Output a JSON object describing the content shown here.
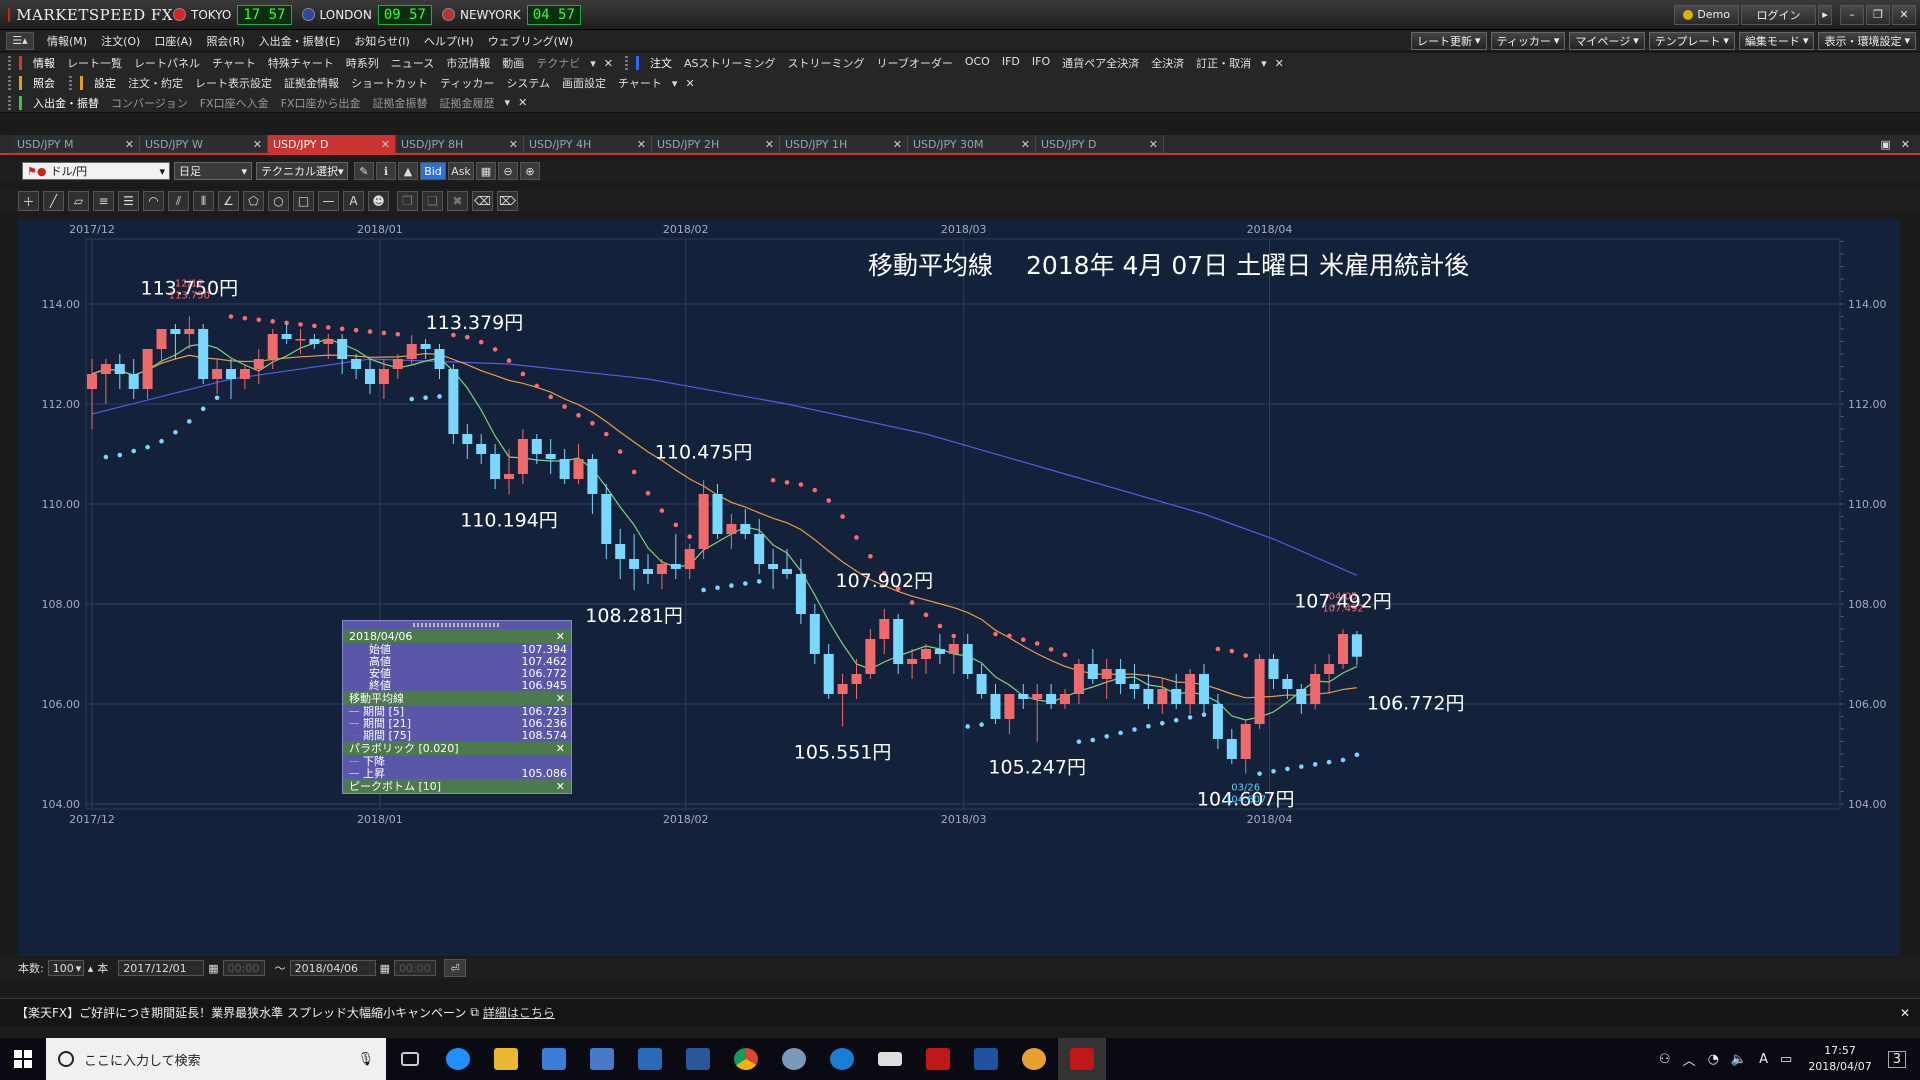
{
  "app": {
    "title": "MARKETSPEED FX",
    "clocks": [
      {
        "city": "TOKYO",
        "time": "17 57",
        "flag": "#dd2222"
      },
      {
        "city": "LONDON",
        "time": "09 57",
        "flag": "#2a4aa0"
      },
      {
        "city": "NEWYORK",
        "time": "04 57",
        "flag": "#c03030"
      }
    ],
    "demo_label": "Demo",
    "login_label": "ログイン"
  },
  "menu": {
    "items": [
      "情報(M)",
      "注文(O)",
      "口座(A)",
      "照会(R)",
      "入出金・振替(E)",
      "お知らせ(I)",
      "ヘルプ(H)",
      "ウェブリング(W)"
    ],
    "right_buttons": [
      "レート更新",
      "ティッカー",
      "マイページ",
      "テンプレート",
      "編集モード",
      "表示・環境設定"
    ]
  },
  "toolbar1": {
    "info_head": "情報",
    "info_items": [
      "レート一覧",
      "レートパネル",
      "チャート",
      "特殊チャート",
      "時系列",
      "ニュース",
      "市況情報",
      "動画"
    ],
    "info_dim": "テクナビ",
    "order_head": "注文",
    "order_items": [
      "ASストリーミング",
      "ストリーミング",
      "リーブオーダー",
      "OCO",
      "IFD",
      "IFO",
      "通貨ペア全決済",
      "全決済",
      "訂正・取消"
    ]
  },
  "toolbar2": {
    "query_head": "照会",
    "settings_head": "設定",
    "settings_items": [
      "注文・約定",
      "レート表示設定",
      "証拠金情報",
      "ショートカット",
      "ティッカー",
      "システム",
      "画面設定",
      "チャート"
    ]
  },
  "toolbar3": {
    "funds_head": "入出金・振替",
    "funds_items": [
      "コンバージョン",
      "FX口座へ入金",
      "FX口座から出金",
      "証拠金振替",
      "証拠金履歴"
    ]
  },
  "tabs": [
    "USD/JPY M",
    "USD/JPY W",
    "USD/JPY D",
    "USD/JPY 8H",
    "USD/JPY 4H",
    "USD/JPY 2H",
    "USD/JPY 1H",
    "USD/JPY 30M",
    "USD/JPY D"
  ],
  "active_tab_index": 2,
  "controls": {
    "pair": "ドル/円",
    "period": "日足",
    "technical": "テクニカル選択",
    "bid": "Bid",
    "ask": "Ask"
  },
  "chart_data": {
    "type": "candlestick",
    "title": "移動平均線　 2018年 4月 07日 土曜日 米雇用統計後",
    "ylim": [
      103.9,
      115.3
    ],
    "yticks": [
      "114.00",
      "112.00",
      "110.00",
      "108.00",
      "106.00",
      "104.00"
    ],
    "ytick_values": [
      114,
      112,
      110,
      108,
      106,
      104
    ],
    "xticks": [
      {
        "label": "2017/12",
        "index": 0
      },
      {
        "label": "2018/01",
        "index": 21
      },
      {
        "label": "2018/02",
        "index": 43
      },
      {
        "label": "2018/03",
        "index": 63
      },
      {
        "label": "2018/04",
        "index": 85
      }
    ],
    "ohlc": [
      [
        112.3,
        112.9,
        111.5,
        112.6
      ],
      [
        112.6,
        112.9,
        112.0,
        112.8
      ],
      [
        112.8,
        113.0,
        112.3,
        112.6
      ],
      [
        112.6,
        112.9,
        112.1,
        112.3
      ],
      [
        112.3,
        113.1,
        112.1,
        113.1
      ],
      [
        113.1,
        113.5,
        112.8,
        113.5
      ],
      [
        113.5,
        113.6,
        112.9,
        113.4
      ],
      [
        113.4,
        113.75,
        113.1,
        113.5
      ],
      [
        113.5,
        113.6,
        112.4,
        112.5
      ],
      [
        112.5,
        112.9,
        112.2,
        112.7
      ],
      [
        112.7,
        112.9,
        112.1,
        112.5
      ],
      [
        112.5,
        112.8,
        112.3,
        112.7
      ],
      [
        112.7,
        113.1,
        112.4,
        112.9
      ],
      [
        112.9,
        113.5,
        112.7,
        113.4
      ],
      [
        113.4,
        113.6,
        113.2,
        113.3
      ],
      [
        113.3,
        113.5,
        113.0,
        113.3
      ],
      [
        113.3,
        113.4,
        113.1,
        113.2
      ],
      [
        113.2,
        113.4,
        112.9,
        113.3
      ],
      [
        113.3,
        113.4,
        112.6,
        112.9
      ],
      [
        112.9,
        113.0,
        112.5,
        112.7
      ],
      [
        112.7,
        112.9,
        112.2,
        112.4
      ],
      [
        112.4,
        112.9,
        112.1,
        112.7
      ],
      [
        112.7,
        113.0,
        112.5,
        112.9
      ],
      [
        112.9,
        113.379,
        112.8,
        113.2
      ],
      [
        113.2,
        113.3,
        112.9,
        113.1
      ],
      [
        113.1,
        113.2,
        112.5,
        112.7
      ],
      [
        112.7,
        112.8,
        111.2,
        111.4
      ],
      [
        111.4,
        111.6,
        110.9,
        111.2
      ],
      [
        111.2,
        111.4,
        110.8,
        111.0
      ],
      [
        111.0,
        111.2,
        110.3,
        110.5
      ],
      [
        110.5,
        111.1,
        110.194,
        110.6
      ],
      [
        110.6,
        111.5,
        110.4,
        111.3
      ],
      [
        111.3,
        111.4,
        110.8,
        111.0
      ],
      [
        111.0,
        111.3,
        110.6,
        110.9
      ],
      [
        110.9,
        111.1,
        110.4,
        110.5
      ],
      [
        110.5,
        111.2,
        110.4,
        110.9
      ],
      [
        110.9,
        111.0,
        109.8,
        110.2
      ],
      [
        110.2,
        110.4,
        108.9,
        109.2
      ],
      [
        109.2,
        109.5,
        108.5,
        108.9
      ],
      [
        108.9,
        109.4,
        108.281,
        108.7
      ],
      [
        108.7,
        109.0,
        108.4,
        108.6
      ],
      [
        108.6,
        108.9,
        108.3,
        108.8
      ],
      [
        108.8,
        109.4,
        108.5,
        108.7
      ],
      [
        108.7,
        109.2,
        108.5,
        109.1
      ],
      [
        109.1,
        110.475,
        108.9,
        110.2
      ],
      [
        110.2,
        110.4,
        109.3,
        109.4
      ],
      [
        109.4,
        109.8,
        109.1,
        109.6
      ],
      [
        109.6,
        109.9,
        109.3,
        109.4
      ],
      [
        109.4,
        109.7,
        108.6,
        108.8
      ],
      [
        108.8,
        109.1,
        108.3,
        108.7
      ],
      [
        108.7,
        109.1,
        108.5,
        108.6
      ],
      [
        108.6,
        108.9,
        107.6,
        107.8
      ],
      [
        107.8,
        108.0,
        106.8,
        107.0
      ],
      [
        107.0,
        107.2,
        106.1,
        106.2
      ],
      [
        106.2,
        106.6,
        105.551,
        106.4
      ],
      [
        106.4,
        106.9,
        106.1,
        106.6
      ],
      [
        106.6,
        107.5,
        106.5,
        107.3
      ],
      [
        107.3,
        107.902,
        107.0,
        107.7
      ],
      [
        107.7,
        107.8,
        106.6,
        106.8
      ],
      [
        106.8,
        107.1,
        106.5,
        106.9
      ],
      [
        106.9,
        107.2,
        106.6,
        107.1
      ],
      [
        107.1,
        107.4,
        106.8,
        107.0
      ],
      [
        107.0,
        107.3,
        106.6,
        107.2
      ],
      [
        107.2,
        107.4,
        106.5,
        106.6
      ],
      [
        106.6,
        106.8,
        106.1,
        106.2
      ],
      [
        106.2,
        106.4,
        105.6,
        105.7
      ],
      [
        105.7,
        106.2,
        105.4,
        106.2
      ],
      [
        106.2,
        106.4,
        105.9,
        106.1
      ],
      [
        106.1,
        106.4,
        105.247,
        106.2
      ],
      [
        106.2,
        106.4,
        105.9,
        106.0
      ],
      [
        106.0,
        106.3,
        105.9,
        106.2
      ],
      [
        106.2,
        106.9,
        106.0,
        106.8
      ],
      [
        106.8,
        107.1,
        106.4,
        106.5
      ],
      [
        106.5,
        106.9,
        106.1,
        106.7
      ],
      [
        106.7,
        106.9,
        106.2,
        106.4
      ],
      [
        106.4,
        106.8,
        106.1,
        106.3
      ],
      [
        106.3,
        106.6,
        105.9,
        106.0
      ],
      [
        106.0,
        106.5,
        105.8,
        106.3
      ],
      [
        106.3,
        106.6,
        105.9,
        106.0
      ],
      [
        106.0,
        106.7,
        105.8,
        106.6
      ],
      [
        106.6,
        106.8,
        105.8,
        106.0
      ],
      [
        106.0,
        106.2,
        105.1,
        105.3
      ],
      [
        105.3,
        105.5,
        104.8,
        104.9
      ],
      [
        104.9,
        105.7,
        104.607,
        105.6
      ],
      [
        105.6,
        107.0,
        105.5,
        106.9
      ],
      [
        106.9,
        107.0,
        106.3,
        106.5
      ],
      [
        106.5,
        106.6,
        106.1,
        106.3
      ],
      [
        106.3,
        106.4,
        105.8,
        106.0
      ],
      [
        106.0,
        106.8,
        105.9,
        106.6
      ],
      [
        106.6,
        107.0,
        106.2,
        106.8
      ],
      [
        106.8,
        107.492,
        106.7,
        107.4
      ],
      [
        107.394,
        107.462,
        106.772,
        106.945
      ]
    ],
    "labels": [
      {
        "text": "113.750円",
        "index": 7,
        "price": 113.75,
        "pos": "above"
      },
      {
        "text": "113.379円",
        "index": 23,
        "price": 113.379,
        "pos": "above-right"
      },
      {
        "text": "110.194円",
        "index": 30,
        "price": 110.194,
        "pos": "below"
      },
      {
        "text": "108.281円",
        "index": 39,
        "price": 108.281,
        "pos": "below"
      },
      {
        "text": "110.475円",
        "index": 44,
        "price": 110.475,
        "pos": "above"
      },
      {
        "text": "105.551円",
        "index": 54,
        "price": 105.551,
        "pos": "below"
      },
      {
        "text": "107.902円",
        "index": 57,
        "price": 107.902,
        "pos": "above"
      },
      {
        "text": "105.247円",
        "index": 68,
        "price": 105.247,
        "pos": "below"
      },
      {
        "text": "104.607円",
        "index": 83,
        "price": 104.607,
        "pos": "below"
      },
      {
        "text": "107.492円",
        "index": 90,
        "price": 107.492,
        "pos": "above"
      },
      {
        "text": "106.772円",
        "index": 91,
        "price": 106.772,
        "pos": "right"
      }
    ],
    "small_labels": [
      {
        "text": "12/12",
        "index": 7,
        "price": 113.75,
        "color": "#ff6b6b",
        "pos": "top1"
      },
      {
        "text": "113.750",
        "index": 7,
        "price": 113.75,
        "color": "#ff6b6b",
        "pos": "top2"
      },
      {
        "text": "03/26",
        "index": 83,
        "price": 104.607,
        "color": "#5ad0ff",
        "pos": "bot1"
      },
      {
        "text": "104.607",
        "index": 83,
        "price": 104.607,
        "color": "#5ad0ff",
        "pos": "bot2"
      },
      {
        "text": "04/05",
        "index": 90,
        "price": 107.492,
        "color": "#ff6b6b",
        "pos": "top1"
      },
      {
        "text": "107.492",
        "index": 90,
        "price": 107.492,
        "color": "#ff6b6b",
        "pos": "top2"
      }
    ],
    "ma_colors": {
      "ma5": "#7fd37f",
      "ma21": "#e89a4a",
      "ma75": "#5a5ae8"
    },
    "ma75": [
      [
        0,
        111.8
      ],
      [
        10,
        112.5
      ],
      [
        20,
        112.9
      ],
      [
        30,
        112.8
      ],
      [
        40,
        112.5
      ],
      [
        50,
        112.0
      ],
      [
        60,
        111.4
      ],
      [
        70,
        110.6
      ],
      [
        80,
        109.8
      ],
      [
        85,
        109.3
      ],
      [
        91,
        108.574
      ]
    ],
    "psar": {
      "color_down": "#ff6b6b",
      "color_up": "#7ad7ff"
    },
    "colors": {
      "up": "#ef6b6b",
      "down": "#7ad7ff"
    }
  },
  "info_panel": {
    "date": "2018/04/06",
    "ohlc_rows": [
      {
        "label": "始値",
        "value": "107.394"
      },
      {
        "label": "高値",
        "value": "107.462"
      },
      {
        "label": "安値",
        "value": "106.772"
      },
      {
        "label": "終値",
        "value": "106.945"
      }
    ],
    "ma_header": "移動平均線",
    "ma_rows": [
      {
        "label": "期間 [5]",
        "value": "106.723",
        "color": "#7fd37f"
      },
      {
        "label": "期間 [21]",
        "value": "106.236",
        "color": "#e89a4a"
      },
      {
        "label": "期間 [75]",
        "value": "108.574",
        "color": "#5a5ae8"
      }
    ],
    "psar_header": "パラボリック [0.020]",
    "psar_rows": [
      {
        "label": "下降",
        "value": "",
        "color": "#ff6b6b"
      },
      {
        "label": "上昇",
        "value": "105.086",
        "color": "#7ad7ff"
      }
    ],
    "peak_header": "ピークボトム [10]"
  },
  "bottom": {
    "count_label": "本数:",
    "count_value": "100",
    "unit": "本",
    "from_date": "2017/12/01",
    "from_time": "00:00",
    "tilde": "～",
    "to_date": "2018/04/06",
    "to_time": "00:00"
  },
  "news": {
    "text": "【楽天FX】ご好評につき期間延長！業界最狭水準 スプレッド大幅縮小キャンペーン",
    "link": "詳細はこちら"
  },
  "taskbar": {
    "search_placeholder": "ここに入力して検索",
    "time": "17:57",
    "date": "2018/04/07",
    "ime": "A",
    "notif": "3"
  }
}
